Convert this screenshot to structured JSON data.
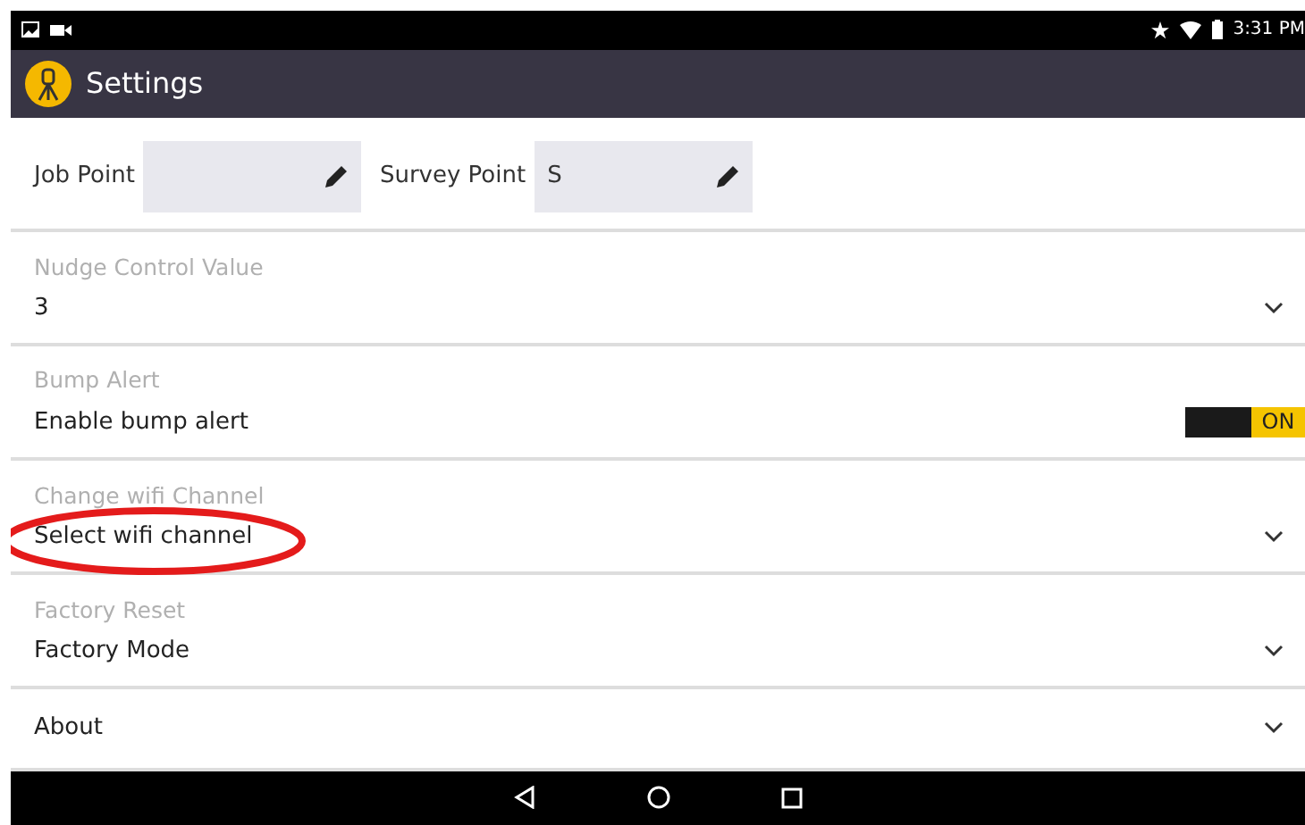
{
  "status_bar": {
    "time": "3:31 PM"
  },
  "app_bar": {
    "title": "Settings"
  },
  "sections": [
    {
      "kind": "fields",
      "fields": [
        {
          "label": "Job Point"
        },
        {
          "label": "Survey Point",
          "value": "S"
        }
      ]
    },
    {
      "kind": "dropdown",
      "label": "Nudge Control Value",
      "value": "3"
    },
    {
      "kind": "toggle",
      "label": "Bump Alert",
      "value": "Enable bump alert",
      "on": true,
      "state_text": "ON"
    },
    {
      "kind": "dropdown",
      "label": "Change wifi Channel",
      "value": "Select wifi channel",
      "highlighted": true
    },
    {
      "kind": "dropdown",
      "label": "Factory Reset",
      "value": "Factory Mode"
    },
    {
      "kind": "dropdown",
      "value": "About"
    }
  ]
}
